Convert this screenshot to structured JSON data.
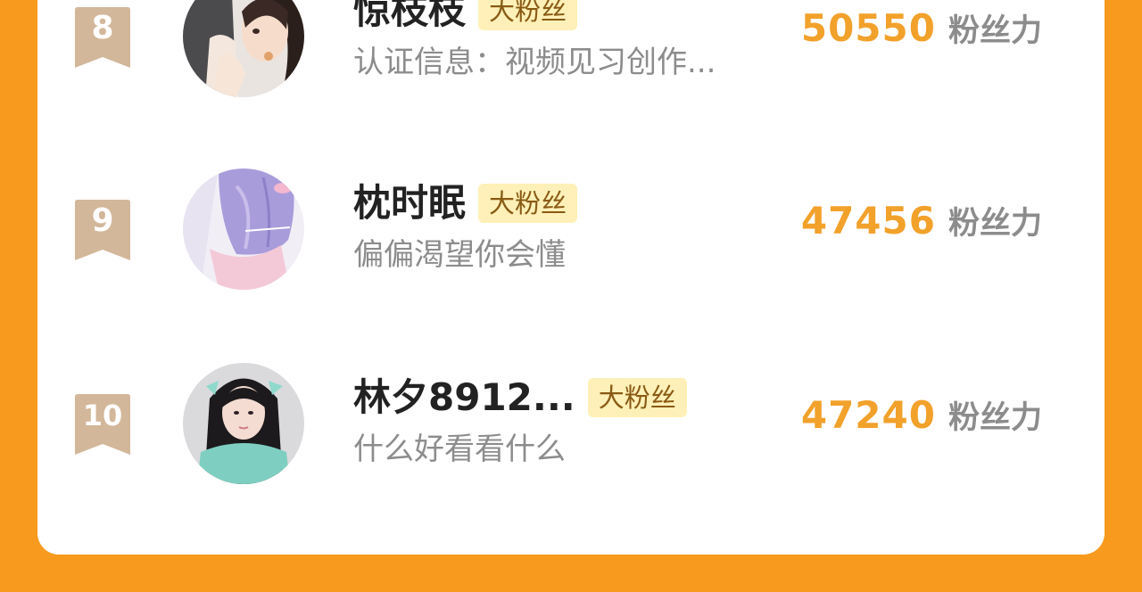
{
  "colors": {
    "background": "#F79A1D",
    "card": "#FFFFFF",
    "score": "#F2A12B",
    "badge_bg": "#FEF0B8",
    "rank_ribbon": "#D3B79A"
  },
  "list": [
    {
      "rank": "8",
      "name": "惊枝枝",
      "badge": "大粉丝",
      "description": "认证信息：视频见习创作...",
      "score": "50550",
      "score_unit": "粉丝力",
      "avatar_icon": "anime-couple-avatar"
    },
    {
      "rank": "9",
      "name": "枕时眠",
      "badge": "大粉丝",
      "description": "偏偏渴望你会懂",
      "score": "47456",
      "score_unit": "粉丝力",
      "avatar_icon": "lavender-anime-avatar"
    },
    {
      "rank": "10",
      "name": "林夕8912...",
      "badge": "大粉丝",
      "description": "什么好看看什么",
      "score": "47240",
      "score_unit": "粉丝力",
      "avatar_icon": "girl-photo-avatar"
    }
  ]
}
